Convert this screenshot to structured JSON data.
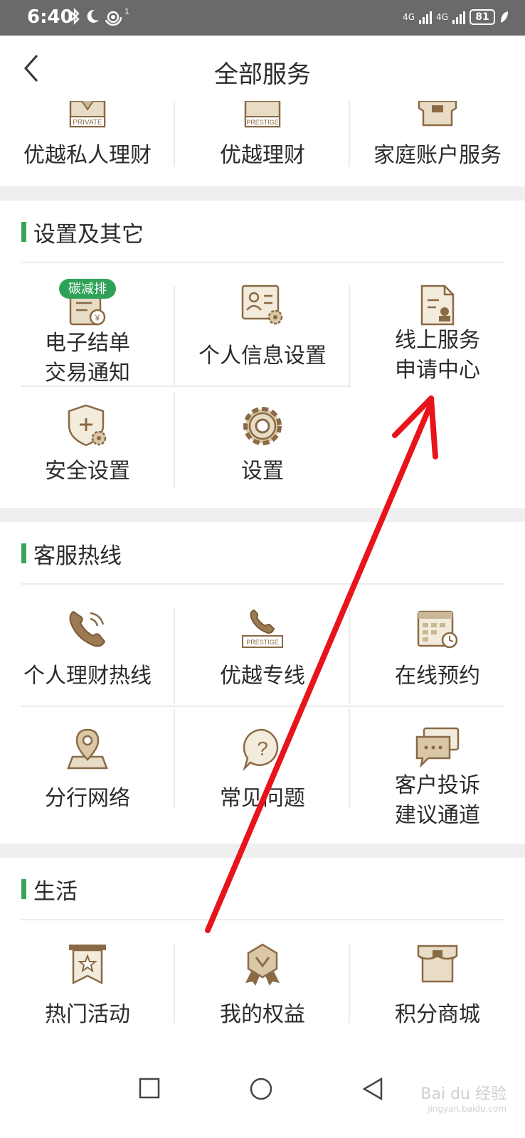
{
  "status": {
    "time": "6:40",
    "network1": "4G",
    "network2": "4G",
    "battery": "81",
    "hotspot_badge": "1"
  },
  "header": {
    "title": "全部服务"
  },
  "top_row": [
    {
      "label": "优越私人理财",
      "icon": "private-badge-icon",
      "badge_text": "PRIVATE"
    },
    {
      "label": "优越理财",
      "icon": "prestige-badge-icon",
      "badge_text": "PRESTIGE"
    },
    {
      "label": "家庭账户服务",
      "icon": "family-account-icon"
    }
  ],
  "settings": {
    "title": "设置及其它",
    "items": [
      {
        "label_line1": "电子结单",
        "label_line2": "交易通知",
        "icon": "e-statement-icon",
        "badge": "碳减排"
      },
      {
        "label": "个人信息设置",
        "icon": "profile-settings-icon"
      },
      {
        "label_line1": "线上服务",
        "label_line2": "申请中心",
        "icon": "online-service-icon"
      },
      {
        "label": "安全设置",
        "icon": "security-shield-icon"
      },
      {
        "label": "设置",
        "icon": "gear-icon"
      }
    ]
  },
  "hotline": {
    "title": "客服热线",
    "items": [
      {
        "label": "个人理财热线",
        "icon": "phone-icon"
      },
      {
        "label": "优越专线",
        "icon": "prestige-phone-icon",
        "badge_text": "PRESTIGE"
      },
      {
        "label": "在线预约",
        "icon": "calendar-icon"
      },
      {
        "label": "分行网络",
        "icon": "map-pin-icon"
      },
      {
        "label": "常见问题",
        "icon": "question-bubble-icon"
      },
      {
        "label_line1": "客户投诉",
        "label_line2": "建议通道",
        "icon": "chat-bubbles-icon"
      }
    ]
  },
  "life": {
    "title": "生活",
    "items": [
      {
        "label": "热门活动",
        "icon": "star-banner-icon"
      },
      {
        "label": "我的权益",
        "icon": "rights-badge-icon"
      },
      {
        "label": "积分商城",
        "icon": "store-icon"
      }
    ]
  },
  "watermark": {
    "text": "Bai du 经验",
    "sub": "jingyan.baidu.com"
  },
  "colors": {
    "accent_green": "#3aa55a",
    "icon_brown": "#8a6a45",
    "icon_fill": "#e8dcc6",
    "arrow_red": "#e8141c"
  }
}
